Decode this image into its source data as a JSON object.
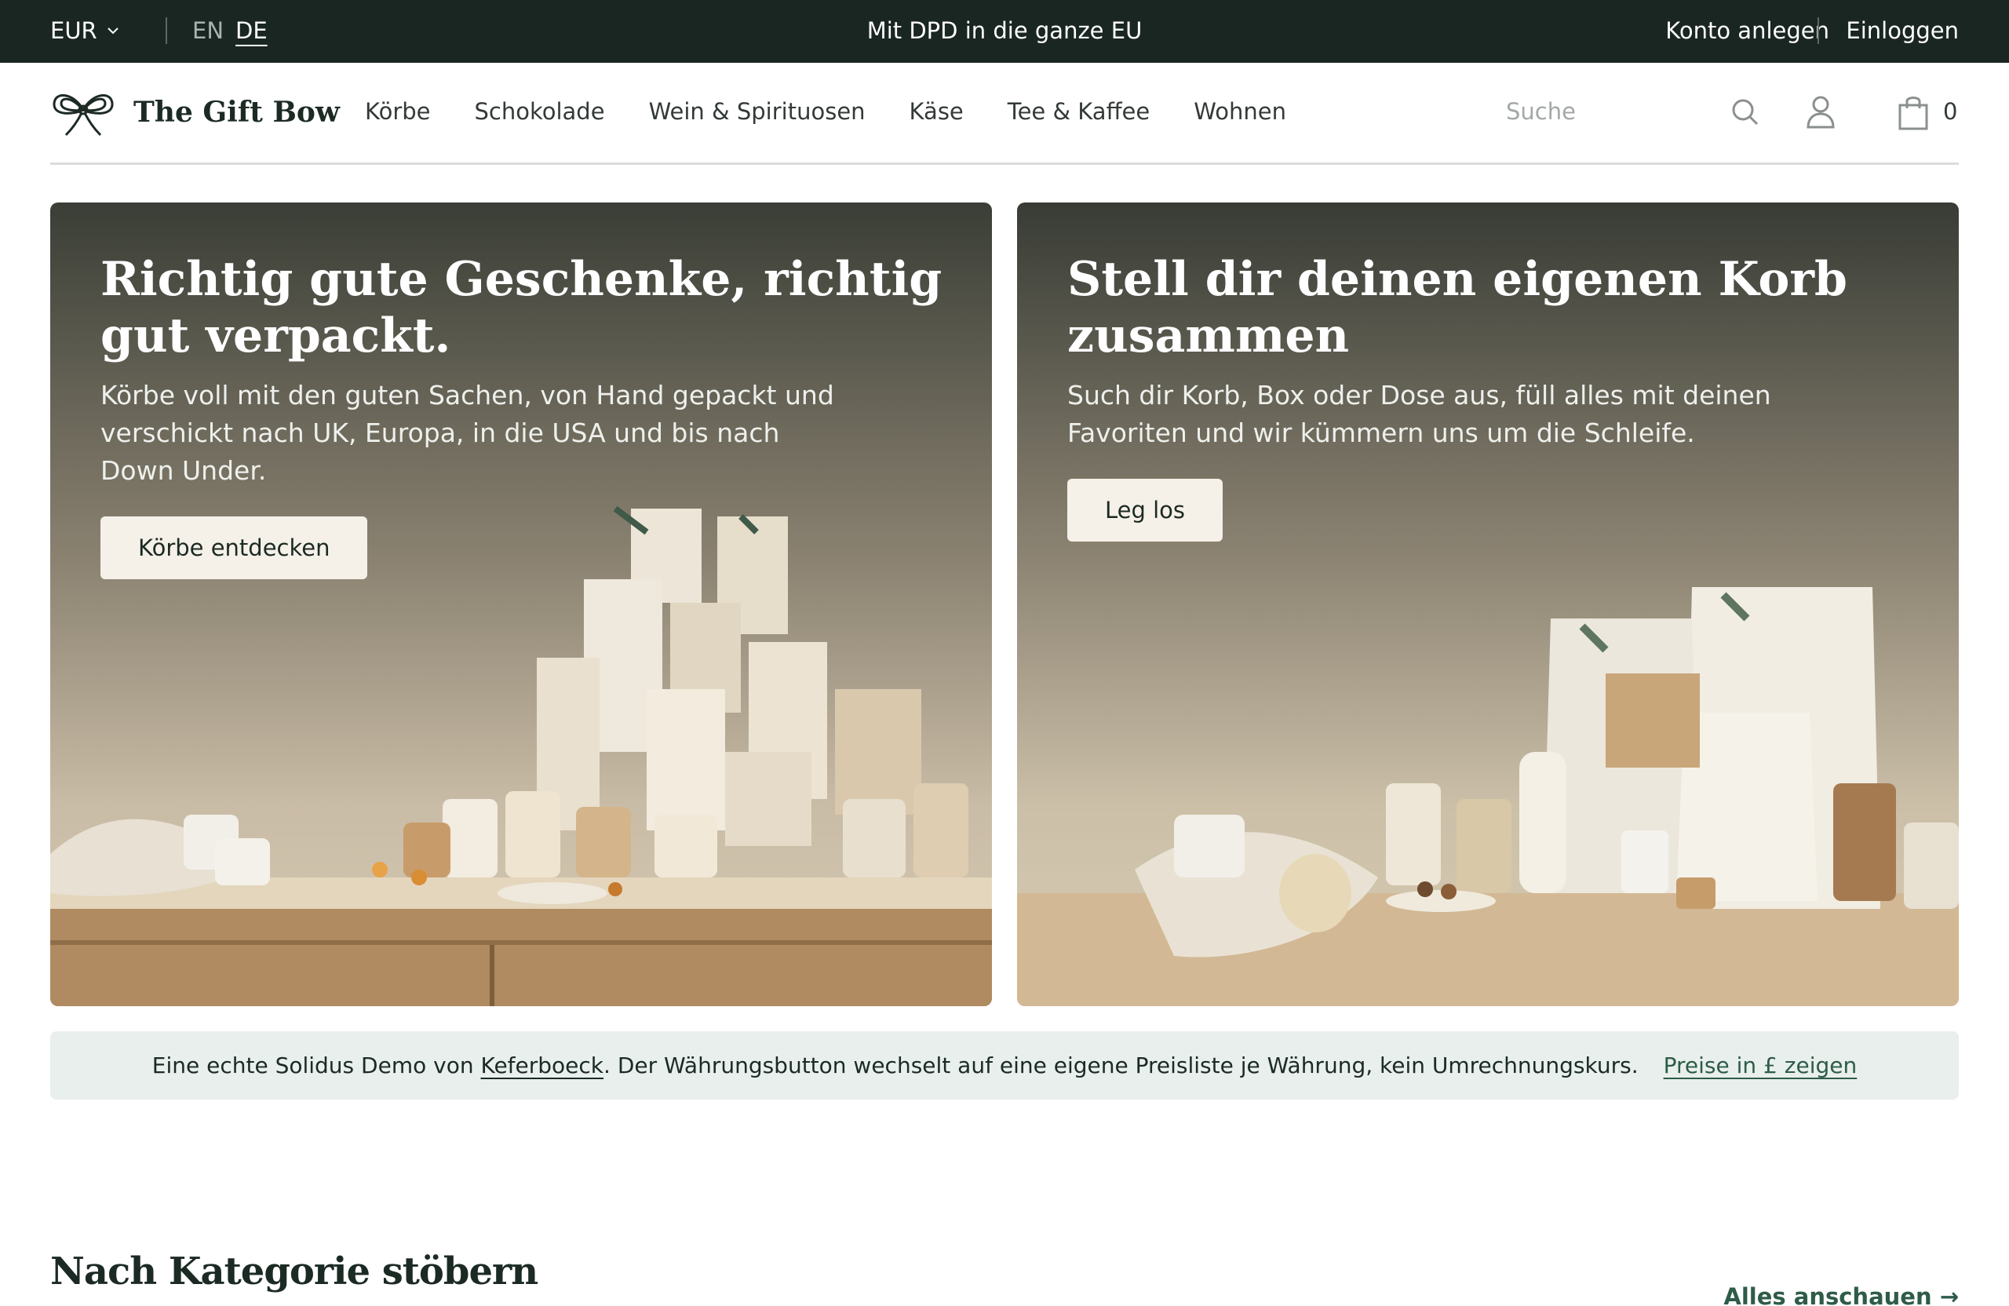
{
  "topbar": {
    "currency": "EUR",
    "languages": [
      "EN",
      "DE"
    ],
    "active_language": "DE",
    "shipping_text": "Mit DPD in die ganze EU",
    "create_account": "Konto anlegen",
    "login": "Einloggen"
  },
  "header": {
    "brand": "The Gift Bow",
    "nav": [
      "Körbe",
      "Schokolade",
      "Wein & Spirituosen",
      "Käse",
      "Tee & Kaffee",
      "Wohnen"
    ],
    "search_placeholder": "Suche",
    "cart_count": "0",
    "icons": [
      "bow-logo-icon",
      "search-icon",
      "user-icon",
      "shopping-bag-icon"
    ]
  },
  "hero_left": {
    "title": "Richtig gute Geschenke, richtig gut verpackt.",
    "text": "Körbe voll mit den guten Sachen, von Hand gepackt und verschickt nach UK, Europa, in die USA und bis nach Down Under.",
    "cta": "Körbe entdecken"
  },
  "hero_right": {
    "title": "Stell dir deinen eigenen Korb zusammen",
    "text": "Such dir Korb, Box oder Dose aus, füll alles mit deinen Favoriten und wir kümmern uns um die Schleife.",
    "cta": "Leg los"
  },
  "notice": {
    "prefix": "Eine echte Solidus Demo von ",
    "link": "Keferboeck",
    "suffix": ". Der Währungsbutton wechselt auf eine eigene Preisliste je Währung, kein Umrechnungskurs.",
    "action": "Preise in £ zeigen"
  },
  "categories": {
    "title": "Nach Kategorie stöbern",
    "see_all": "Alles anschauen →"
  },
  "colors": {
    "topbar_bg": "#1a2622",
    "accent_green": "#2e5c48",
    "button_bg": "#f5f1e8",
    "notice_bg": "#e8efec"
  }
}
